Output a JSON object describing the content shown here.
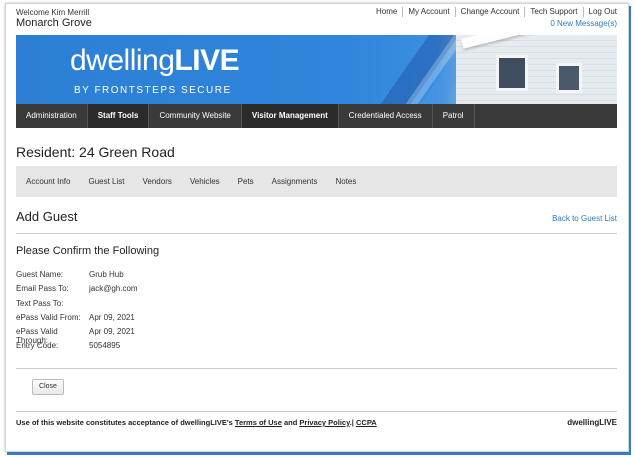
{
  "header": {
    "welcome": "Welcome Kim Merrill",
    "community": "Monarch Grove",
    "links": [
      "Home",
      "My Account",
      "Change Account",
      "Tech Support",
      "Log Out"
    ],
    "messages": "0 New Message(s)"
  },
  "banner": {
    "brand_light": "dwelling",
    "brand_bold": "LIVE",
    "tagline": "BY FRONTSTEPS SECURE"
  },
  "main_nav": [
    "Administration",
    "Staff Tools",
    "Community Website",
    "Visitor Management",
    "Credentialed Access",
    "Patrol"
  ],
  "resident_title": "Resident: 24 Green Road",
  "sub_nav": [
    "Account Info",
    "Guest List",
    "Vendors",
    "Vehicles",
    "Pets",
    "Assignments",
    "Notes"
  ],
  "page": {
    "title": "Add Guest",
    "back_link": "Back to Guest List",
    "confirm_heading": "Please Confirm the Following",
    "details": [
      {
        "label": "Guest Name:",
        "value": "Grub Hub"
      },
      {
        "label": "Email Pass To:",
        "value": "jack@gh.com"
      },
      {
        "label": "Text Pass To:",
        "value": ""
      },
      {
        "label": "ePass Valid From:",
        "value": "Apr 09, 2021"
      },
      {
        "label": "ePass Valid Through:",
        "value": "Apr 09, 2021"
      },
      {
        "label": "Entry Code:",
        "value": "5054895"
      }
    ],
    "close_label": "Close"
  },
  "footer": {
    "text_prefix": "Use of this website constitutes acceptance of dwellingLIVE's ",
    "terms": "Terms of Use",
    "and": " and ",
    "privacy": "Privacy Policy",
    "sep": ".| ",
    "ccpa": "CCPA",
    "brand": "dwellingLIVE"
  },
  "colors": {
    "link": "#2b7bc4",
    "nav_bg": "#3a3a3a",
    "banner": "#2f86dc"
  }
}
